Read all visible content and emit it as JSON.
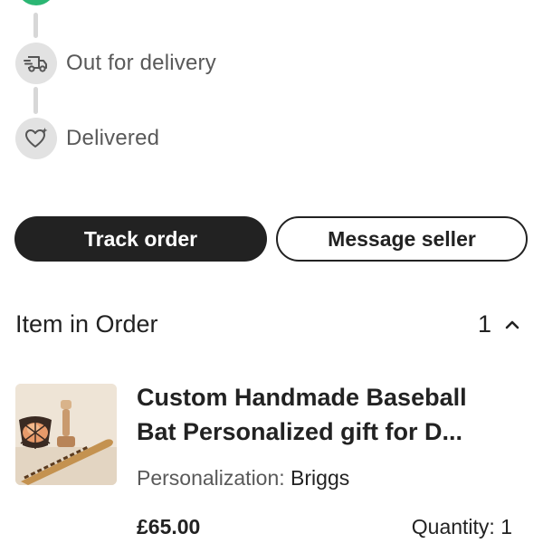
{
  "timeline": {
    "steps": [
      {
        "label": "Out for delivery",
        "icon": "delivery-truck-icon"
      },
      {
        "label": "Delivered",
        "icon": "heart-sparkle-icon"
      }
    ],
    "completed_color": "#2bb673"
  },
  "actions": {
    "track_order": "Track order",
    "message_seller": "Message seller"
  },
  "items_section": {
    "title": "Item in Order",
    "count": "1"
  },
  "item": {
    "title_line1": "Custom Handmade Baseball",
    "title_line2": "Bat Personalized gift for D...",
    "personalization_label": "Personalization:",
    "personalization_value": "Briggs",
    "price": "£65.00",
    "quantity": "Quantity: 1",
    "image_icon": "product-photo-baseball-bat"
  }
}
